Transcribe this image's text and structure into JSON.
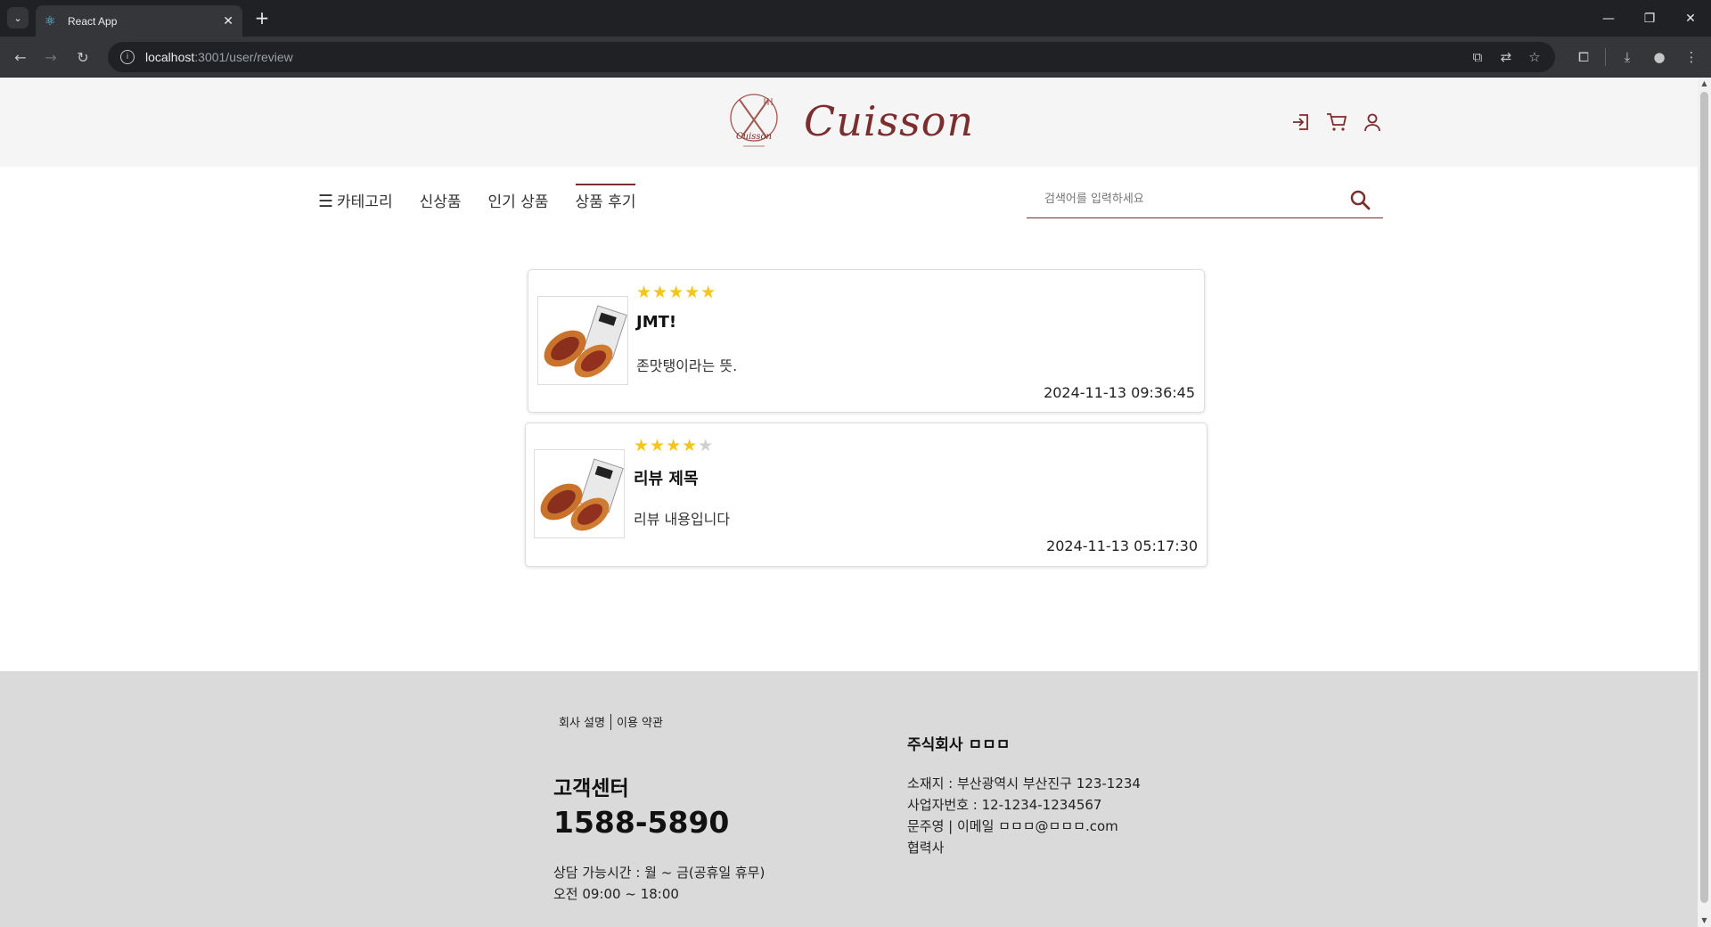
{
  "browser": {
    "tab_title": "React App",
    "url_host": "localhost",
    "url_path": ":3001/user/review"
  },
  "site": {
    "logo_text": "Cuisson",
    "logo_emblem_text": "Cuisson",
    "brand_color": "#7a2e2e",
    "nav": [
      {
        "label": "카테고리",
        "icon": "menu-icon"
      },
      {
        "label": "신상품"
      },
      {
        "label": "인기 상품"
      },
      {
        "label": "상품 후기",
        "active": true
      }
    ],
    "search_placeholder": "검색어를 입력하세요",
    "header_icons": [
      "login-icon",
      "cart-icon",
      "user-icon"
    ]
  },
  "reviews": [
    {
      "rating": 5,
      "stars": "★★★★★",
      "stars_off": "",
      "title": "JMT!",
      "body": "존맛탱이라는 뜻.",
      "date": "2024-11-13 09:36:45"
    },
    {
      "rating": 4,
      "stars": "★★★★",
      "stars_off": "★",
      "title": "리뷰 제목",
      "body": "리뷰 내용입니다",
      "date": "2024-11-13 05:17:30"
    }
  ],
  "footer": {
    "link_about": "회사 설명",
    "link_terms": "이용 약관",
    "cs_label": "고객센터",
    "cs_phone": "1588-5890",
    "cs_hours_1": "상담 가능시간 : 월 ~ 금(공휴일 휴무)",
    "cs_hours_2": "오전 09:00 ~ 18:00",
    "company_name": "주식회사 ㅁㅁㅁ",
    "address": "소재지 : 부산광역시 부산진구 123-1234",
    "biz_number": "사업자번호 : 12-1234-1234567",
    "contact": "문주영 | 이메일 ㅁㅁㅁ@ㅁㅁㅁ.com",
    "partners": "협력사"
  }
}
